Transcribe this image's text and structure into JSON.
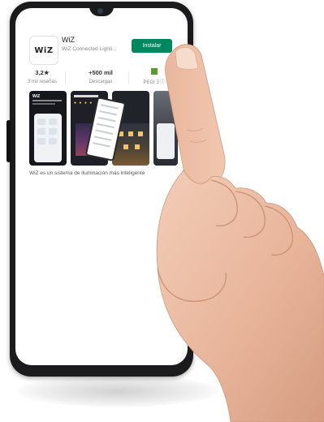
{
  "app": {
    "icon_text": "WiZ",
    "title": "WiZ",
    "developer": "WiZ Connected Lighti...",
    "install_label": "Instalar"
  },
  "stats": {
    "rating": "3,2★",
    "reviews": "3 mil reseñas",
    "downloads": "+500 mil",
    "downloads_label": "Descargas",
    "pegi": "PEGI 3 ⓘ"
  },
  "description": "WiZ es un sistema de iluminación más inteligente",
  "screenshot_text": {
    "shot1_title": "WiZ"
  },
  "colors": {
    "install_bg": "#01875f",
    "phone_body": "#1b1b1d"
  },
  "icons": [
    "pegi-icon",
    "star-icon"
  ]
}
